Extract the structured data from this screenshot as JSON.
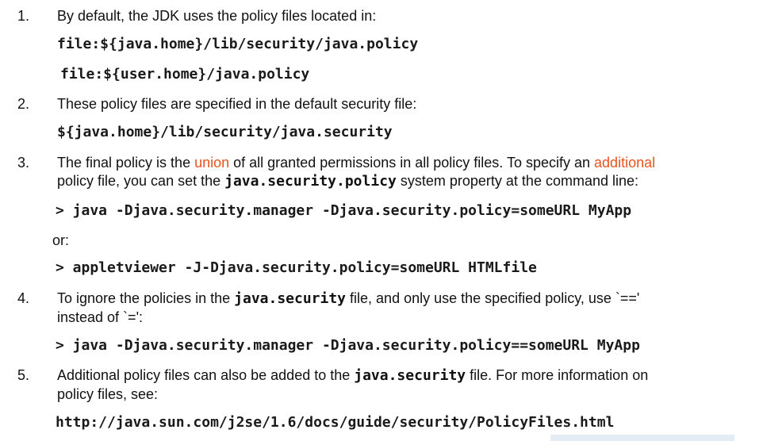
{
  "items": [
    {
      "number": "1.",
      "text": "By default, the JDK uses the policy files located in:",
      "code": [
        "file:${java.home}/lib/security/java.policy",
        "file:${user.home}/java.policy"
      ]
    },
    {
      "number": "2.",
      "text": "These policy files are specified in the default security file:",
      "code": [
        "${java.home}/lib/security/java.security"
      ]
    },
    {
      "number": "3.",
      "line1_a": "The final policy is the ",
      "line1_hl1": "union",
      "line1_b": " of all granted permissions in all policy files. To specify an ",
      "line1_hl2": "additional",
      "line2_a": "policy file, you can set the ",
      "line2_code": "java.security.policy",
      "line2_b": " system property at the command line:",
      "cmd1": "> java -Djava.security.manager -Djava.security.policy=someURL MyApp",
      "or": "or:",
      "cmd2": "> appletviewer -J-Djava.security.policy=someURL HTMLfile"
    },
    {
      "number": "4.",
      "line1_a": "To ignore the policies in the ",
      "line1_code": "java.security",
      "line1_b": " file, and only use the specified policy, use `=='",
      "line2": "instead of `=':",
      "cmd": "> java -Djava.security.manager -Djava.security.policy==someURL MyApp"
    },
    {
      "number": "5.",
      "line1_a": "Additional policy files can also be added to the ",
      "line1_code": "java.security",
      "line1_b": " file. For more information on",
      "line2": "policy files, see:",
      "url": "http://java.sun.com/j2se/1.6/docs/guide/security/PolicyFiles.html"
    }
  ],
  "colors": {
    "highlight": "#e8541c",
    "text": "#111111"
  }
}
